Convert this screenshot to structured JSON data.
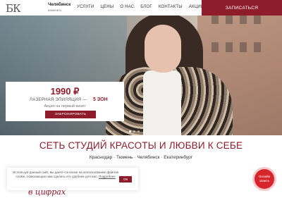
{
  "header": {
    "logo": "БК",
    "city": "Челябинск",
    "city_change": "изменить",
    "nav": [
      "УСЛУГИ",
      "ЦЕНЫ",
      "О НАС",
      "БЛОГ",
      "КОНТАКТЫ",
      "АКЦИИ"
    ],
    "signup": "ЗАПИСАТЬСЯ"
  },
  "promo": {
    "price": "1990 ₽",
    "service": "ЛАЗЕРНАЯ ЭПИЛЯЦИЯ —",
    "count": "5 ЗОН",
    "note": "Акция на первый визит",
    "button": "ЗАБРОНИРОВАТЬ",
    "prev_icon": "‹",
    "next_icon": "›"
  },
  "main": {
    "headline": "СЕТЬ СТУДИЙ КРАСОТЫ И ЛЮБВИ К СЕБЕ",
    "cities": "Краснодар · Тюмень · Челябинск · Екатеринбург"
  },
  "cookie": {
    "text": "Используя данный сайт, вы даете согласие на использование файлов cookie, помогающих нам сделать его удобнее для вас.",
    "link": "Подробнее",
    "ok": "ОК"
  },
  "script_text": "в цифрах",
  "chat": {
    "line1": "Онлайн",
    "line2": "запись"
  },
  "colors": {
    "accent": "#8e1c2b",
    "chat": "#d7262b"
  }
}
